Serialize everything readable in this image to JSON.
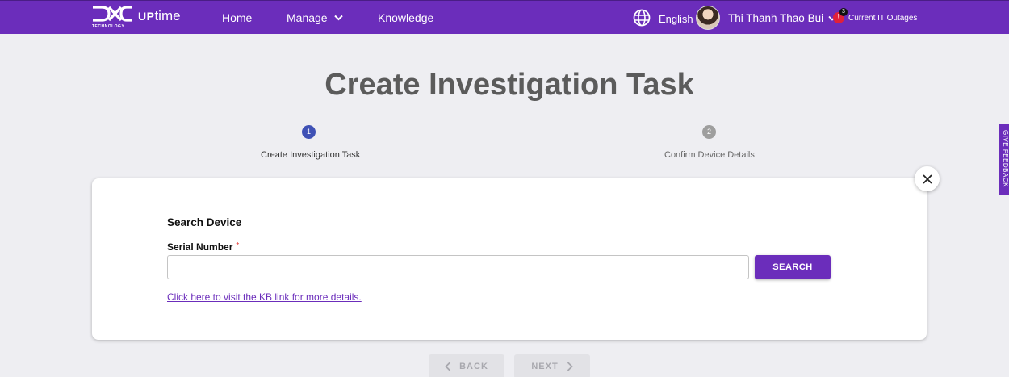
{
  "header": {
    "logo_mark": "DXC",
    "logo_sub": "TECHNOLOGY",
    "app_name_bold": "UP",
    "app_name_rest": "time",
    "nav": {
      "home": "Home",
      "manage": "Manage",
      "knowledge": "Knowledge"
    },
    "language": "English",
    "user_name": "Thi Thanh Thao Bui",
    "alert_count": "3",
    "alert_symbol": "!",
    "outages_label": "Current IT Outages"
  },
  "page": {
    "title": "Create Investigation Task"
  },
  "stepper": {
    "steps": [
      {
        "number": "1",
        "label": "Create Investigation Task",
        "state": "active"
      },
      {
        "number": "2",
        "label": "Confirm Device Details",
        "state": "inactive"
      }
    ]
  },
  "feedback_tab": "GIVE FEEDBACK",
  "form": {
    "section_title": "Search Device",
    "serial_label": "Serial Number",
    "required_marker": "*",
    "serial_value": "",
    "serial_placeholder": "",
    "search_button": "SEARCH",
    "kb_link": "Click here to visit the KB link for more details."
  },
  "footer_nav": {
    "back": "BACK",
    "next": "NEXT"
  },
  "colors": {
    "brand_purple": "#6b2dbb",
    "step_active": "#3f51b5",
    "step_inactive": "#9e9e9e",
    "alert_red": "#e0203a",
    "page_bg": "#eeeef2"
  },
  "icons": [
    "globe-icon",
    "chevron-down-icon",
    "alert-icon",
    "close-icon",
    "chevron-left-icon",
    "chevron-right-icon"
  ]
}
